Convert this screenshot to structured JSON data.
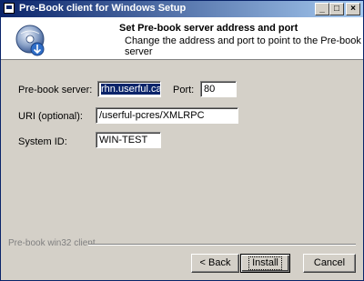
{
  "window": {
    "title": "Pre-Book client for Windows Setup",
    "controls": {
      "minimize": "_",
      "maximize": "□",
      "close": "×"
    }
  },
  "header": {
    "title": "Set Pre-book server address and port",
    "subtitle": "Change the address and port to point to the Pre-book server",
    "logo_icon": "prebook-disc-icon"
  },
  "form": {
    "server_label": "Pre-book server:",
    "server_value": "rhn.userful.ca",
    "port_label": "Port:",
    "port_value": "80",
    "uri_label": "URI (optional):",
    "uri_value": "/userful-pcres/XMLRPC",
    "system_id_label": "System ID:",
    "system_id_value": "WIN-TEST"
  },
  "footer": {
    "branding": "Pre-book win32 client",
    "back_label": "< Back",
    "install_label": "Install",
    "cancel_label": "Cancel"
  },
  "colors": {
    "titlebar_start": "#0a246a",
    "titlebar_end": "#a6caf0",
    "dialog_bg": "#d4d0c8",
    "selection": "#0a246a"
  }
}
